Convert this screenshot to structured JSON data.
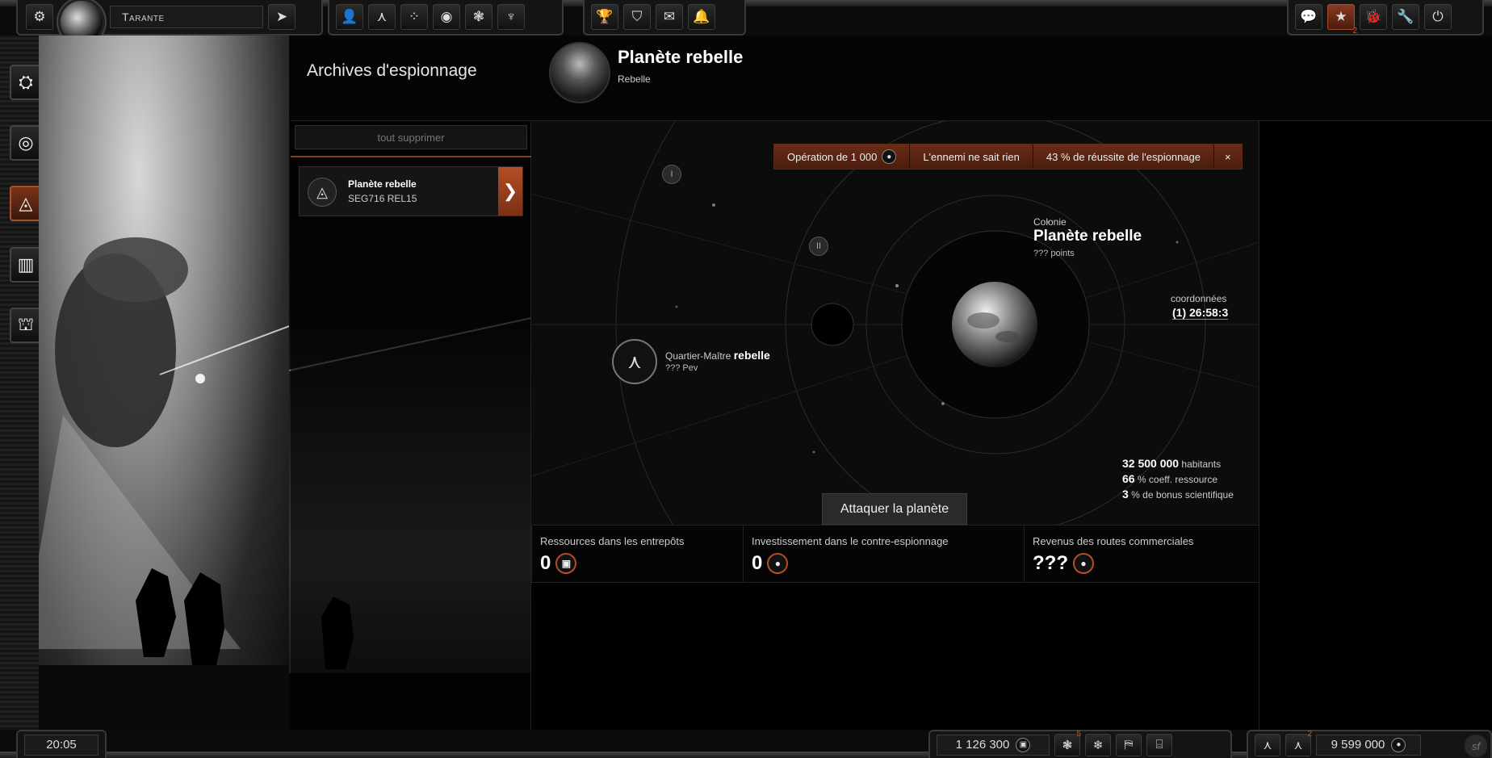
{
  "topbar": {
    "planet_name": "Tarante",
    "icons": [
      "settings-icon",
      "send-icon",
      "profile-icon",
      "fleet-icon",
      "galaxy-icon",
      "resource-icon",
      "technology-icon",
      "faction-icon",
      "trophy-icon",
      "shield-icon",
      "mail-icon",
      "bell-icon",
      "chat-icon",
      "star-icon",
      "bug-icon",
      "wrench-icon",
      "power-icon"
    ],
    "favorites_count": "2"
  },
  "sidebar": {
    "items": [
      "building-icon",
      "radar-icon",
      "espionage-icon",
      "shipyard-icon",
      "defense-icon"
    ],
    "active": "espionage-icon"
  },
  "header": {
    "page_title": "Archives d'espionnage",
    "target_name": "Planète rebelle",
    "target_faction": "Rebelle"
  },
  "reports": {
    "clear_all": "tout supprimer",
    "items": [
      {
        "title": "Planète rebelle",
        "code": "SEG716 REL15",
        "arrow": "❯"
      }
    ]
  },
  "map": {
    "info": {
      "operation": "Opération de 1 000",
      "enemy_status": "L'ennemi ne sait rien",
      "success": "43 % de réussite de l'espionnage",
      "close": "×"
    },
    "orbits": [
      "I",
      "II"
    ],
    "colony": {
      "kind": "Colonie",
      "name": "Planète rebelle",
      "points": "??? points",
      "coords_label": "coordonnées",
      "coords_value": "(1) 26:58:3"
    },
    "stats": {
      "population_value": "32 500 000",
      "population_label": "habitants",
      "resource_value": "66",
      "resource_label": "% coeff. ressource",
      "science_value": "3",
      "science_label": "% de bonus scientifique"
    },
    "commander": {
      "role": "Quartier-Maître",
      "faction": "rebelle",
      "pev": "??? Pev"
    },
    "attack_label": "Attaquer la planète"
  },
  "resources": [
    {
      "label": "Ressources dans les entrepôts",
      "value": "0",
      "icon": "cube-icon"
    },
    {
      "label": "Investissement dans le contre-espionnage",
      "value": "0",
      "icon": "credit-icon"
    },
    {
      "label": "Revenus des routes commerciales",
      "value": "???",
      "icon": "credit-icon"
    }
  ],
  "bottombar": {
    "time": "20:05",
    "resources_amount": "1 126 300",
    "tech_badge": "5",
    "credits_amount": "9 599 000",
    "fleet_badge": "2",
    "logo": "sf"
  },
  "colors": {
    "accent": "#b34e26",
    "accent_dark": "#4a1d0d",
    "background": "#000000"
  }
}
